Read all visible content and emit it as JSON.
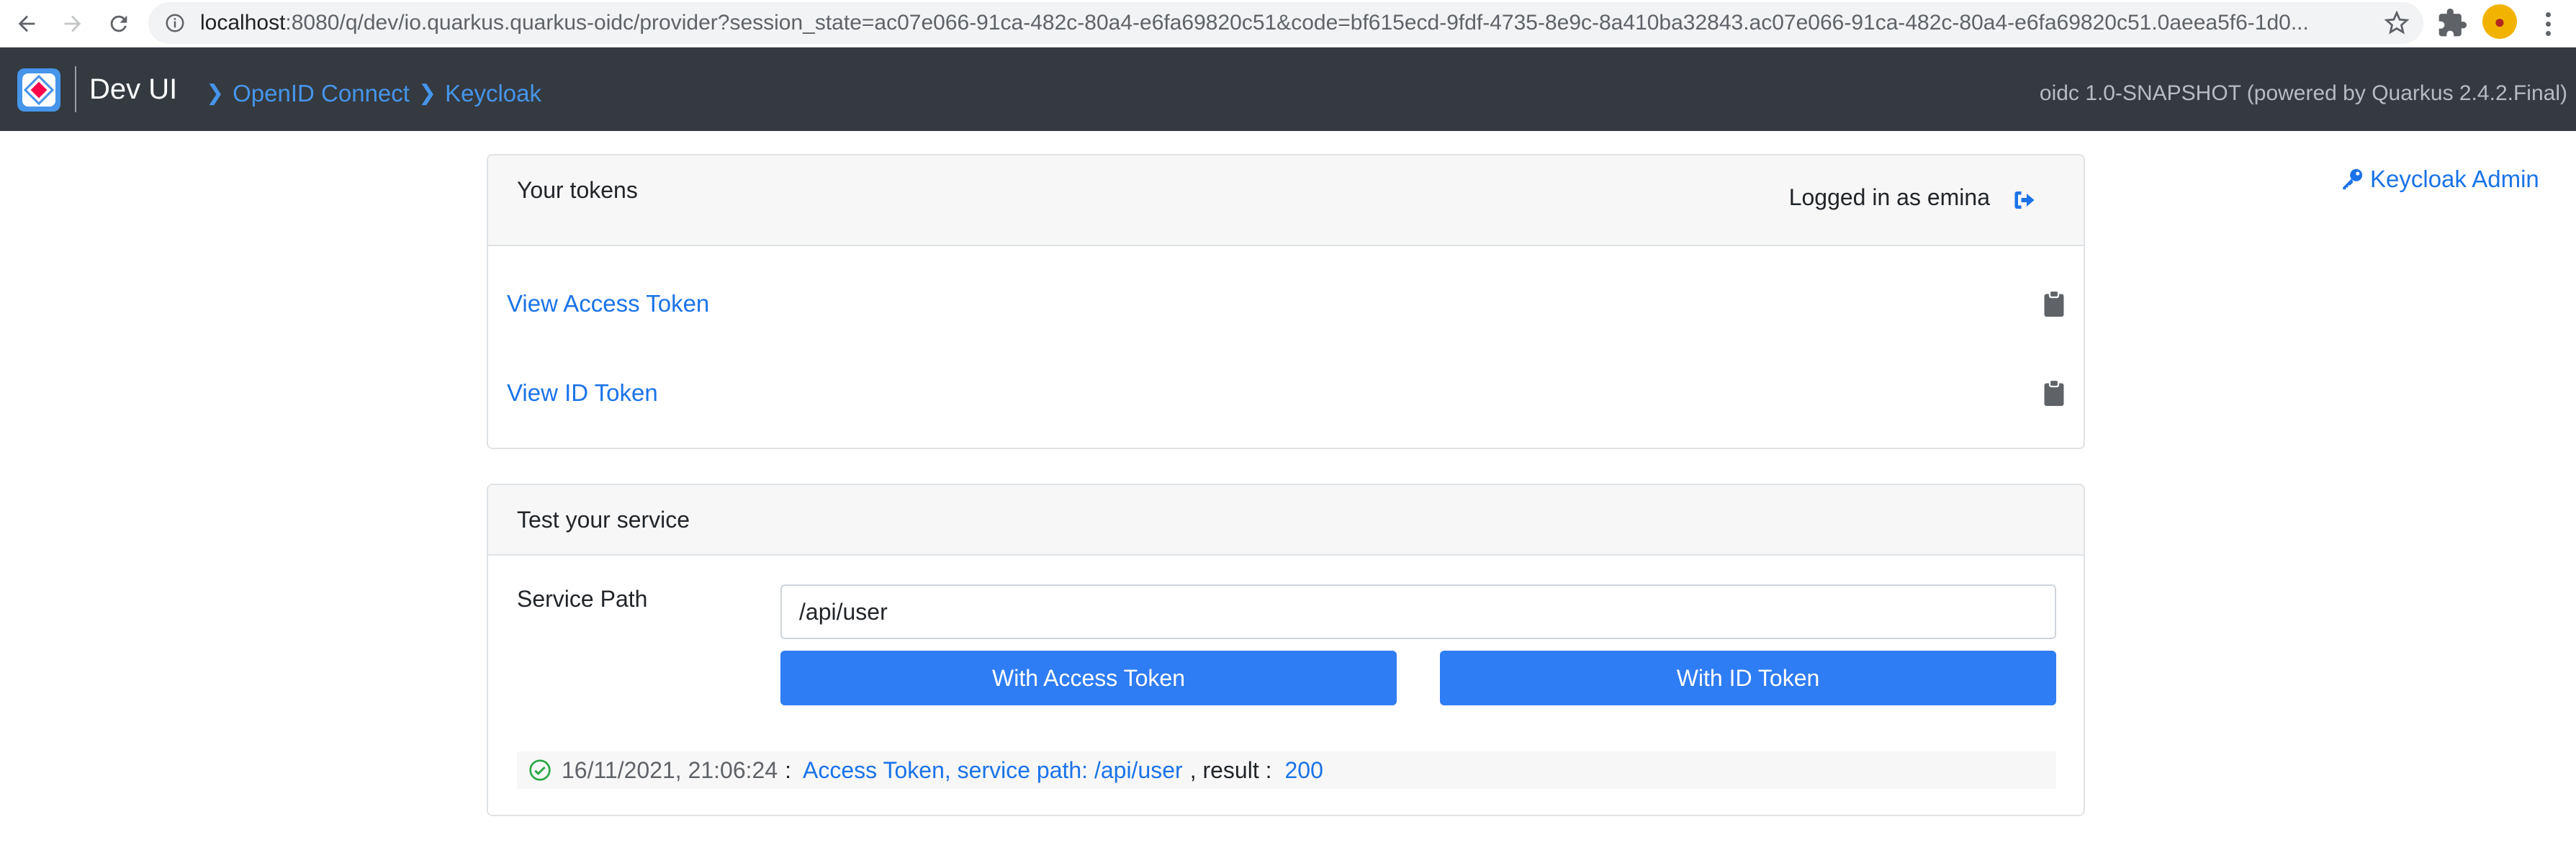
{
  "browser": {
    "url_host": "localhost",
    "url_rest": ":8080/q/dev/io.quarkus.quarkus-oidc/provider?session_state=ac07e066-91ca-482c-80a4-e6fa69820c51&code=bf615ecd-9fdf-4735-8e9c-8a410ba32843.ac07e066-91ca-482c-80a4-e6fa69820c51.0aeea5f6-1d0..."
  },
  "navbar": {
    "title": "Dev UI",
    "breadcrumbs": [
      "OpenID Connect",
      "Keycloak"
    ],
    "version": "oidc 1.0-SNAPSHOT (powered by Quarkus 2.4.2.Final)"
  },
  "admin_link": "Keycloak Admin",
  "tokens": {
    "header": "Your tokens",
    "logged_in": "Logged in as emina",
    "access_token_link": "View Access Token",
    "id_token_link": "View ID Token"
  },
  "service": {
    "header": "Test your service",
    "path_label": "Service Path",
    "path_value": "/api/user",
    "btn_access": "With Access Token",
    "btn_id": "With ID Token",
    "result": {
      "timestamp": "16/11/2021, 21:06:24",
      "colon": ":",
      "description": "Access Token, service path: /api/user",
      "label": ", result :",
      "code": "200"
    }
  },
  "colors": {
    "navbar_bg": "#343a40",
    "link": "#1a73e8",
    "button": "#2f7df4",
    "success": "#28a745"
  }
}
